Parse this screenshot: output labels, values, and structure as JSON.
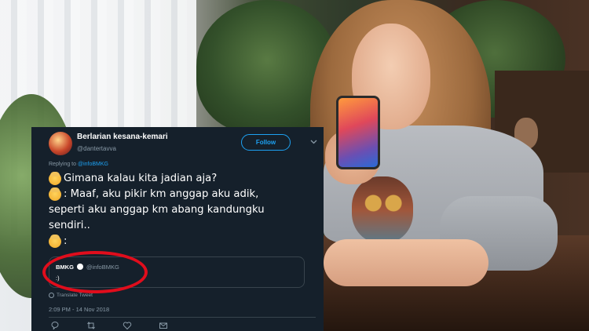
{
  "tweet": {
    "display_name": "Berlarian kesana-kemari",
    "handle": "@dantertavva",
    "follow_label": "Follow",
    "replying_prefix": "Replying to ",
    "replying_to": "@infoBMKG",
    "lines": [
      "Gimana kalau kita jadian aja?",
      ": Maaf, aku pikir km anggap aku adik,",
      "seperti aku anggap km abang kandungku",
      "sendiri..",
      ":"
    ],
    "quote": {
      "name": "BMKG",
      "handle": "@infoBMKG",
      "text": ":)"
    },
    "translate_label": "Translate Tweet",
    "timestamp": "2:09 PM - 14 Nov 2018"
  },
  "colors": {
    "card_bg": "#15202b",
    "accent": "#1da1f2",
    "highlight_circle": "#e00d1c"
  },
  "icons": [
    "chevron-down-icon",
    "verified-icon",
    "globe-icon",
    "reply-icon",
    "retweet-icon",
    "like-icon",
    "message-icon"
  ]
}
